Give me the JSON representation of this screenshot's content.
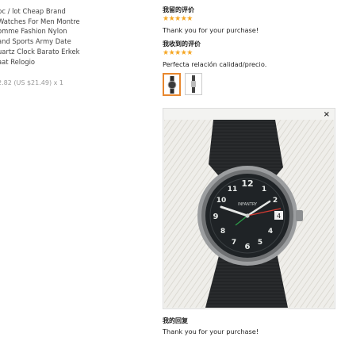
{
  "product": {
    "title_lines": [
      "pc / lot Cheap Brand",
      "Watches For Men Montre",
      "omme Fashion Nylon",
      "and Sports Army Date",
      "uartz Clock Barato Erkek",
      "aat Relogio"
    ],
    "price": "2.82 (US $21.49) x 1"
  },
  "my_review": {
    "heading": "我留的评价",
    "stars": "★★★★★",
    "rating": 5,
    "text": "Thank you for your purchase!"
  },
  "received_review": {
    "heading": "我收到的评价",
    "stars": "★★★★★",
    "rating": 5,
    "text": "Perfecta relación calidad/precio."
  },
  "viewer": {
    "close_label": "×",
    "watch_brand_text": "INFANTRY"
  },
  "my_reply": {
    "heading": "我的回复",
    "text": "Thank you for your purchase!"
  },
  "colors": {
    "star": "#f5a623",
    "selected_thumb_border": "#e8872e"
  }
}
